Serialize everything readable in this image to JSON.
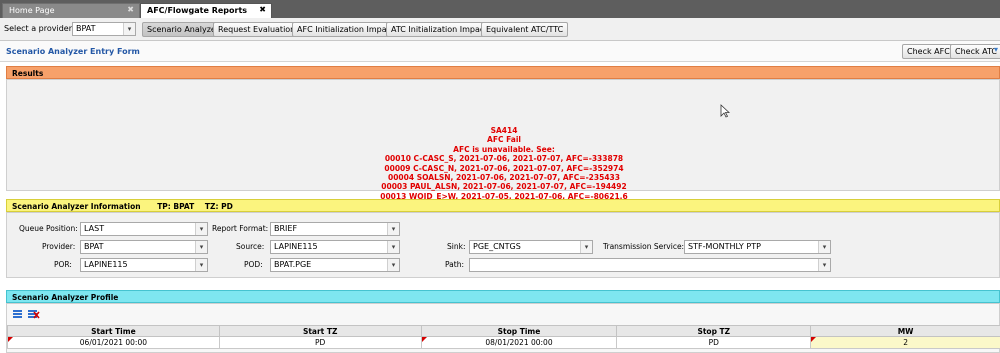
{
  "tabs": [
    {
      "label": "Home Page",
      "active": false
    },
    {
      "label": "AFC/Flowgate Reports",
      "active": true
    }
  ],
  "toolbar": {
    "provider_label": "Select a provider",
    "provider_value": "BPAT",
    "buttons": [
      "Scenario Analyzer",
      "Request Evaluations",
      "AFC Initialization Impacts",
      "ATC Initialization Impacts",
      "Equivalent ATC/TTC"
    ]
  },
  "form": {
    "title": "Scenario Analyzer Entry Form",
    "check_afc": "Check AFC",
    "check_atc": "Check ATC"
  },
  "results": {
    "title": "Results",
    "lines": [
      "SA414",
      "AFC Fail",
      "AFC is unavailable. See:",
      "00010 C-CASC_S, 2021-07-06, 2021-07-07, AFC=-333878",
      "00009 C-CASC_N, 2021-07-06, 2021-07-07, AFC=-352974",
      "00004 SOALSN, 2021-07-06, 2021-07-07, AFC=-235433",
      "00003 PAUL_ALSN, 2021-07-06, 2021-07-07, AFC=-194492",
      "00013 WOJD_E>W, 2021-07-05, 2021-07-06, AFC=-80621.6"
    ]
  },
  "info": {
    "title": "Scenario Analyzer Information",
    "tp": "TP: BPAT",
    "tz": "TZ: PD",
    "queue_position_label": "Queue Position:",
    "queue_position_value": "LAST",
    "report_format_label": "Report Format:",
    "report_format_value": "BRIEF",
    "provider_label": "Provider:",
    "provider_value": "BPAT",
    "source_label": "Source:",
    "source_value": "LAPINE115",
    "sink_label": "Sink:",
    "sink_value": "PGE_CNTGS",
    "transmission_service_label": "Transmission Service:",
    "transmission_service_value": "STF-MONTHLY PTP",
    "por_label": "POR:",
    "por_value": "LAPINE115",
    "pod_label": "POD:",
    "pod_value": "BPAT.PGE",
    "path_label": "Path:",
    "path_value": ""
  },
  "profile": {
    "title": "Scenario Analyzer Profile",
    "columns": [
      "Start Time",
      "Start TZ",
      "Stop Time",
      "Stop TZ",
      "MW"
    ],
    "rows": [
      [
        "06/01/2021 00:00",
        "PD",
        "08/01/2021 00:00",
        "PD",
        "2"
      ]
    ]
  }
}
